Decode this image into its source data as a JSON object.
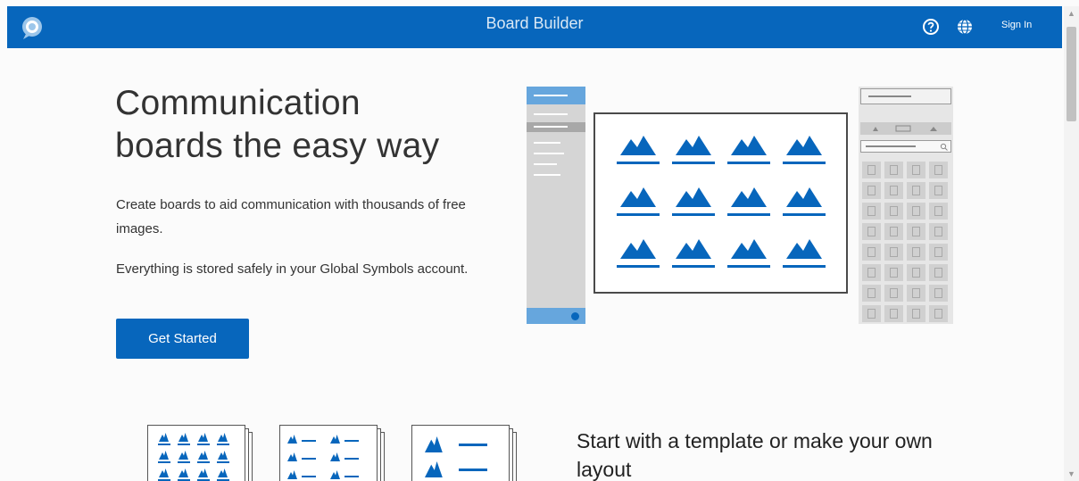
{
  "header": {
    "title": "Board Builder",
    "sign_in": "Sign In",
    "icons": [
      "logo-icon",
      "help-icon",
      "globe-icon"
    ]
  },
  "hero": {
    "title_line1": "Communication",
    "title_line2": "boards the easy way",
    "paragraph1": "Create boards to aid communication with thousands of free images.",
    "paragraph2": "Everything is stored safely in your Global Symbols account.",
    "cta_label": "Get Started"
  },
  "templates": {
    "heading": "Start with a template or make your own layout"
  },
  "colors": {
    "brand_blue": "#0766bc",
    "light_blue": "#66a6dd",
    "text": "#333333"
  }
}
